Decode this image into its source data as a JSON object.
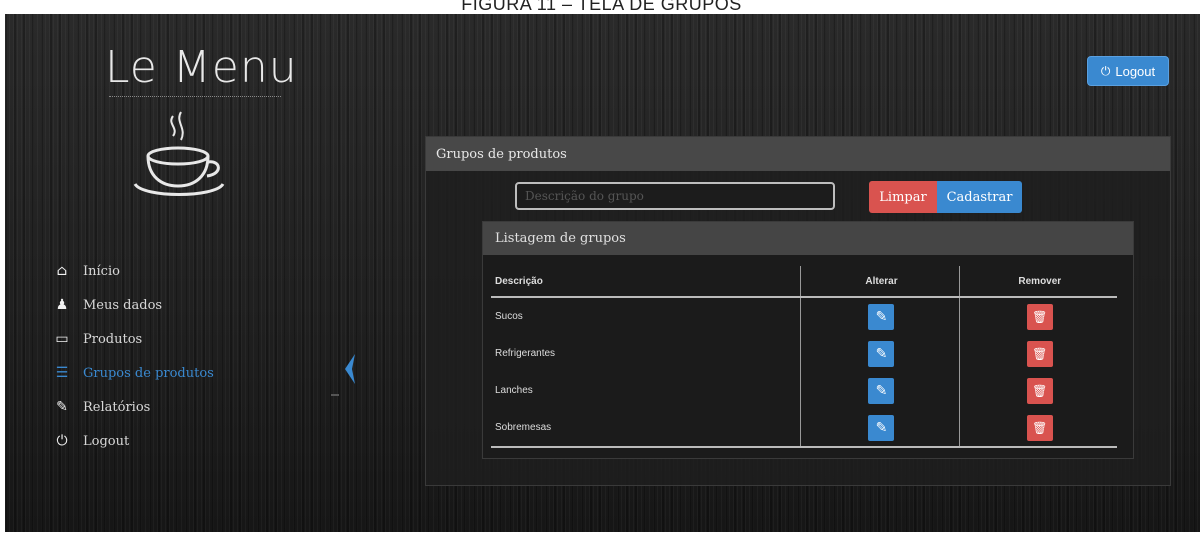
{
  "caption": "FIGURA 11 – TELA DE GRUPOS",
  "brand": {
    "name": "Le Menu",
    "logo": "coffee-cup-icon"
  },
  "header": {
    "logout_label": "Logout",
    "logout_icon": "power-icon"
  },
  "sidebar": {
    "items": [
      {
        "label": "Início",
        "icon": "home-icon",
        "active": false
      },
      {
        "label": "Meus dados",
        "icon": "user-icon",
        "active": false
      },
      {
        "label": "Produtos",
        "icon": "monitor-icon",
        "active": false
      },
      {
        "label": "Grupos de produtos",
        "icon": "list-icon",
        "active": true
      },
      {
        "label": "Relatórios",
        "icon": "edit-icon",
        "active": false
      },
      {
        "label": "Logout",
        "icon": "power-icon",
        "active": false
      }
    ]
  },
  "main": {
    "panel_title": "Grupos de produtos",
    "search_placeholder": "Descrição do grupo",
    "clear_label": "Limpar",
    "add_label": "Cadastrar",
    "list": {
      "title": "Listagem de grupos",
      "columns": [
        "Descrição",
        "Alterar",
        "Remover"
      ],
      "rows": [
        "Sucos",
        "Refrigerantes",
        "Lanches",
        "Sobremesas"
      ]
    }
  },
  "colors": {
    "primary": "#3a89d0",
    "danger": "#d9534f",
    "background": "#1f1f1f"
  }
}
